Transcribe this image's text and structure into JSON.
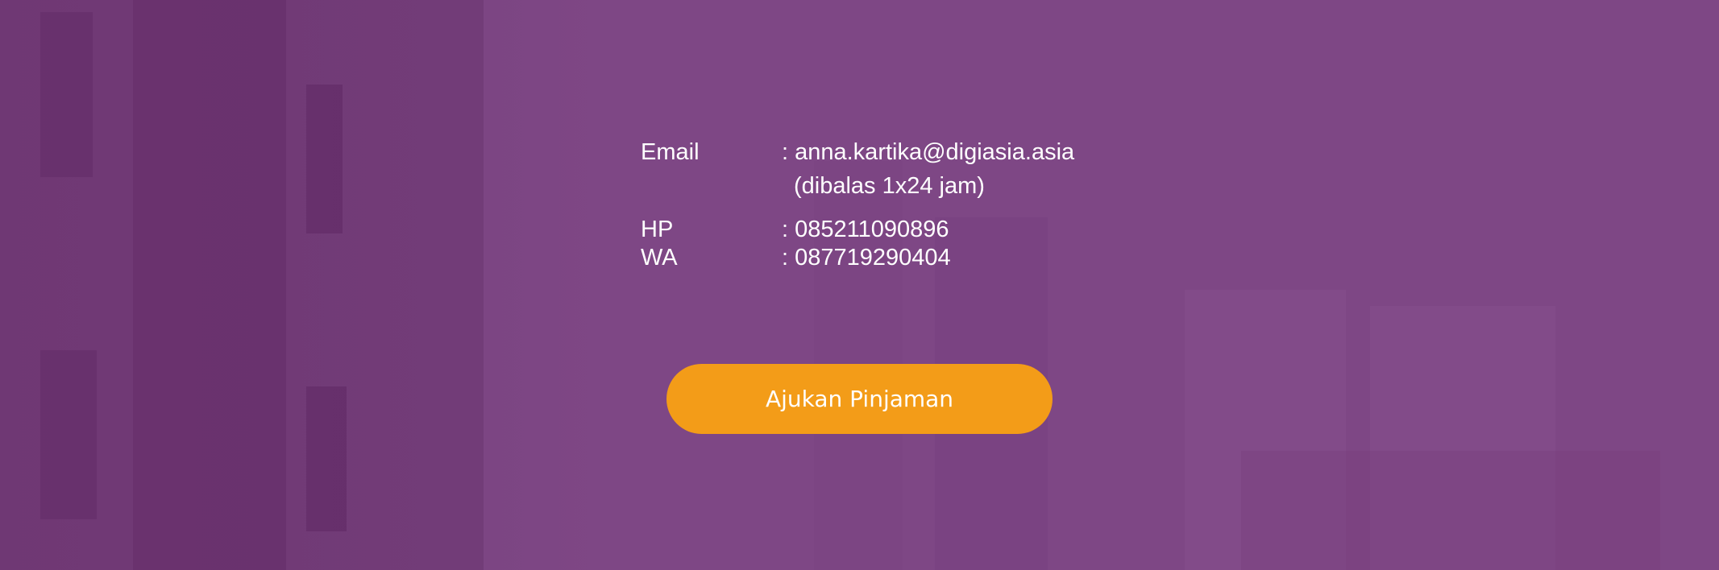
{
  "contact": {
    "email_label": "Email",
    "email_value": ": anna.kartika@digiasia.asia",
    "email_note": "(dibalas 1x24 jam)",
    "hp_label": "HP",
    "hp_value": ": 085211090896",
    "wa_label": "WA",
    "wa_value": ": 087719290404"
  },
  "cta": {
    "label": "Ajukan Pinjaman"
  },
  "colors": {
    "background": "#7e4785",
    "button": "#f39c18",
    "text": "#ffffff"
  }
}
